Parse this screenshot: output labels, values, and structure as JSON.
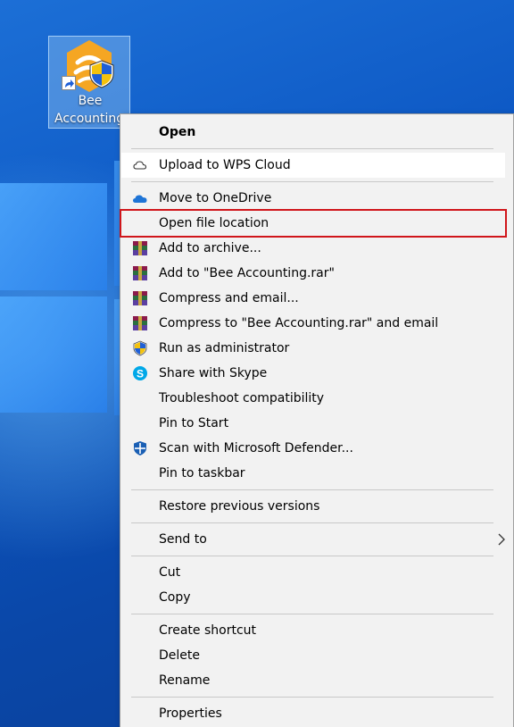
{
  "desktop_icon": {
    "label_line1": "Bee",
    "label_line2": "Accounting",
    "icon": "bee-accounting-logo-icon",
    "badges": [
      "shortcut-arrow-icon",
      "uac-shield-icon"
    ]
  },
  "context_menu": {
    "highlighted_item": "Open file location",
    "items": [
      {
        "label": "Open",
        "icon": "none",
        "bold": true
      },
      {
        "label": "Upload to WPS Cloud",
        "icon": "cloud-outline-icon"
      },
      {
        "label": "Move to OneDrive",
        "icon": "onedrive-icon"
      },
      {
        "label": "Open file location",
        "icon": "none"
      },
      {
        "label": "Add to archive...",
        "icon": "winrar-icon"
      },
      {
        "label": "Add to \"Bee Accounting.rar\"",
        "icon": "winrar-icon"
      },
      {
        "label": "Compress and email...",
        "icon": "winrar-icon"
      },
      {
        "label": "Compress to \"Bee Accounting.rar\" and email",
        "icon": "winrar-icon"
      },
      {
        "label": "Run as administrator",
        "icon": "uac-shield-icon"
      },
      {
        "label": "Share with Skype",
        "icon": "skype-icon"
      },
      {
        "label": "Troubleshoot compatibility",
        "icon": "none"
      },
      {
        "label": "Pin to Start",
        "icon": "none"
      },
      {
        "label": "Scan with Microsoft Defender...",
        "icon": "defender-icon"
      },
      {
        "label": "Pin to taskbar",
        "icon": "none"
      },
      {
        "label": "Restore previous versions",
        "icon": "none"
      },
      {
        "label": "Send to",
        "icon": "none",
        "submenu": true
      },
      {
        "label": "Cut",
        "icon": "none"
      },
      {
        "label": "Copy",
        "icon": "none"
      },
      {
        "label": "Create shortcut",
        "icon": "none"
      },
      {
        "label": "Delete",
        "icon": "none"
      },
      {
        "label": "Rename",
        "icon": "none"
      },
      {
        "label": "Properties",
        "icon": "none"
      }
    ]
  },
  "colors": {
    "desktop_blue": "#0d58c4",
    "menu_bg": "#f2f2f2",
    "highlight_border": "#d0161b",
    "separator": "#c8c8c8"
  }
}
